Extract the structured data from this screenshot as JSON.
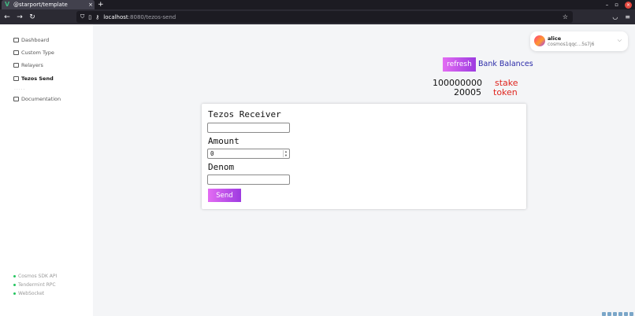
{
  "browser": {
    "tab_title": "@starport/template",
    "tab_close": "×",
    "new_tab": "+",
    "url_host": "localhost",
    "url_path": ":8080/tezos-send",
    "win_min": "–",
    "win_max": "▫",
    "win_close": "×"
  },
  "sidebar": {
    "items": [
      {
        "label": "Dashboard"
      },
      {
        "label": "Custom Type"
      },
      {
        "label": "Relayers"
      },
      {
        "label": "Tezos Send"
      },
      {
        "label": "Documentation"
      }
    ],
    "separator": "·····",
    "links": [
      {
        "label": "Cosmos SDK API"
      },
      {
        "label": "Tendermint RPC"
      },
      {
        "label": "WebSocket"
      }
    ]
  },
  "account": {
    "name": "alice",
    "address": "cosmos1qqc...5s7j6"
  },
  "bank": {
    "refresh_label": "refresh",
    "title": "Bank Balances",
    "balances": [
      {
        "amount": "100000000",
        "denom": "stake"
      },
      {
        "amount": "20005",
        "denom": "token"
      }
    ]
  },
  "form": {
    "receiver_label": "Tezos Receiver",
    "receiver_value": "",
    "amount_label": "Amount",
    "amount_value": "0",
    "denom_label": "Denom",
    "denom_value": "",
    "send_label": "Send"
  },
  "colors": {
    "accent_gradient_start": "#e36cf3",
    "accent_gradient_end": "#9d3be0",
    "bank_title": "#2a2aa8",
    "denom": "#e0261f",
    "status_dot": "#22c55e"
  }
}
